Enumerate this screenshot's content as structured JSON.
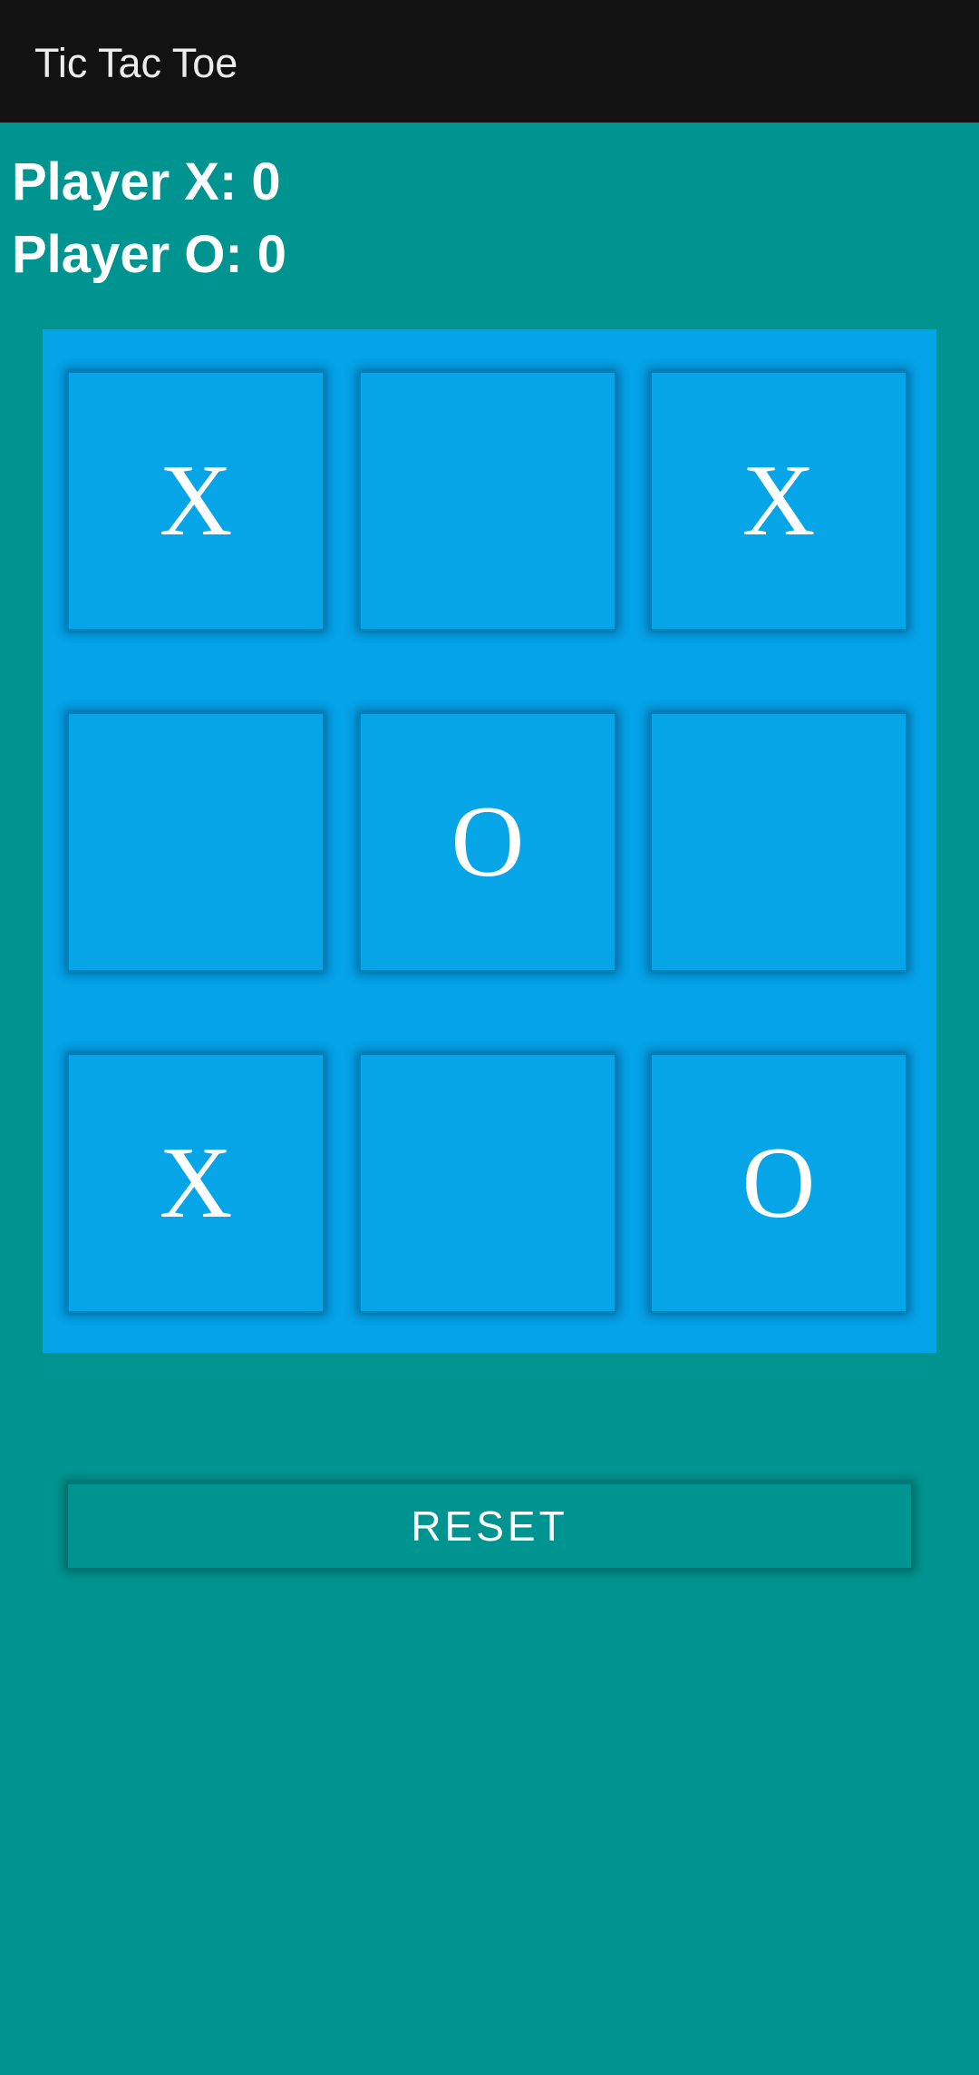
{
  "app_bar": {
    "title": "Tic Tac Toe"
  },
  "scores": {
    "player_x": "Player X: 0",
    "player_o": "Player O: 0"
  },
  "board": {
    "cells": [
      "X",
      "",
      "X",
      "",
      "O",
      "",
      "X",
      "",
      "O"
    ]
  },
  "reset_label": "RESET",
  "colors": {
    "background": "#009490",
    "app_bar": "#121212",
    "board": "#05a3e8",
    "cell": "#06a5e7",
    "text": "#ffffff"
  }
}
